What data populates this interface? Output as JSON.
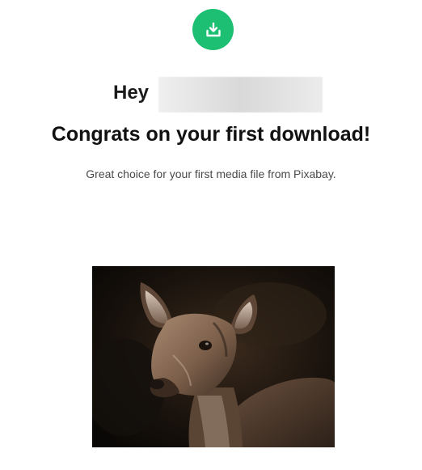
{
  "colors": {
    "accent": "#1dbf73",
    "accent_dark": "#16a862",
    "headline": "#111111",
    "subtext": "#4a4a4a",
    "background": "#ffffff"
  },
  "header": {
    "icon": "download-icon"
  },
  "greeting": {
    "hey": "Hey"
  },
  "headline": "Congrats on your first download!",
  "subtext": "Great choice for your first media file from Pixabay.",
  "image": {
    "subject": "deer-photo"
  }
}
